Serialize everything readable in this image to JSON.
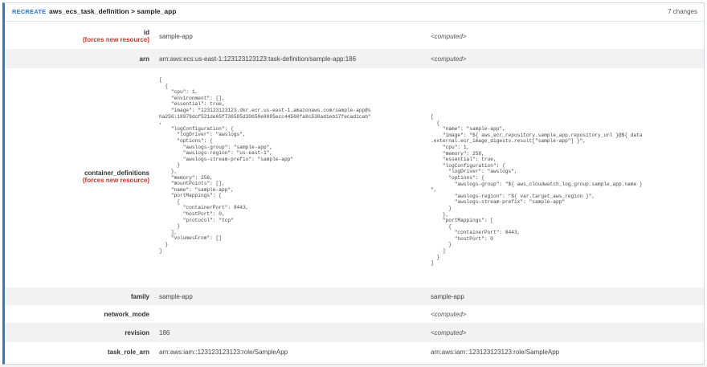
{
  "header": {
    "action": "RECREATE",
    "title": "aws_ecs_task_definition > sample_app",
    "changes": "7 changes"
  },
  "rows": [
    {
      "key": "id",
      "note": "(forces new resource)",
      "old": "sample-app",
      "new": "<computed>"
    },
    {
      "key": "arn",
      "note": "",
      "old": "arn:aws:ecs:us-east-1:123123123123:task-definition/sample-app:186",
      "new": "<computed>"
    },
    {
      "key": "container_definitions",
      "note": "(forces new resource)",
      "old": "[\n  {\n    \"cpu\": 1,\n    \"environment\": [],\n    \"essential\": true,\n    \"image\": \"123123123123.dkr.ecr.us-east-1.amazonaws.com/sample-app@s\nha256:18979dcf521de65f736585d30b58e8085ecc44560fa8c530ad1eb17fecad1cab\"\n,\n    \"logConfiguration\": {\n      \"logDriver\": \"awslogs\",\n      \"options\": {\n        \"awslogs-group\": \"sample-app\",\n        \"awslogs-region\": \"us-east-1\",\n        \"awslogs-stream-prefix\": \"sample-app\"\n      }\n    },\n    \"memory\": 256,\n    \"mountPoints\": [],\n    \"name\": \"sample-app\",\n    \"portMappings\": [\n      {\n        \"containerPort\": 8443,\n        \"hostPort\": 0,\n        \"protocol\": \"tcp\"\n      }\n    ],\n    \"volumesFrom\": []\n  }\n]",
      "new": "[\n  {\n    \"name\": \"sample-app\",\n    \"image\": \"${ aws_ecr_repository.sample_app.repository_url }@${ data\n.external.ecr_image_digests.result[\"sample-app\"] }\",\n    \"cpu\": 1,\n    \"memory\": 256,\n    \"essential\": true,\n    \"logConfiguration\": {\n      \"logDriver\": \"awslogs\",\n      \"options\": {\n        \"awslogs-group\": \"${ aws_cloudwatch_log_group.sample_app.name }\n\",\n        \"awslogs-region\": \"${ var.target_aws_region }\",\n        \"awslogs-stream-prefix\": \"sample-app\"\n      }\n    },\n    \"portMappings\": [\n      {\n        \"containerPort\": 8443,\n        \"hostPort\": 0\n      }\n    ]\n  }\n]"
    },
    {
      "key": "family",
      "note": "",
      "old": "sample-app",
      "new": "sample-app"
    },
    {
      "key": "network_mode",
      "note": "",
      "old": "",
      "new": "<computed>"
    },
    {
      "key": "revision",
      "note": "",
      "old": "186",
      "new": "<computed>"
    },
    {
      "key": "task_role_arn",
      "note": "",
      "old": "arn:aws:iam::123123123123:role/SampleApp",
      "new": "arn:aws:iam::123123123123:role/SampleApp"
    }
  ],
  "colors": {
    "accent": "#2f7bbf",
    "forces_new": "#c0392b",
    "row_alt": "#f2f2f2"
  }
}
